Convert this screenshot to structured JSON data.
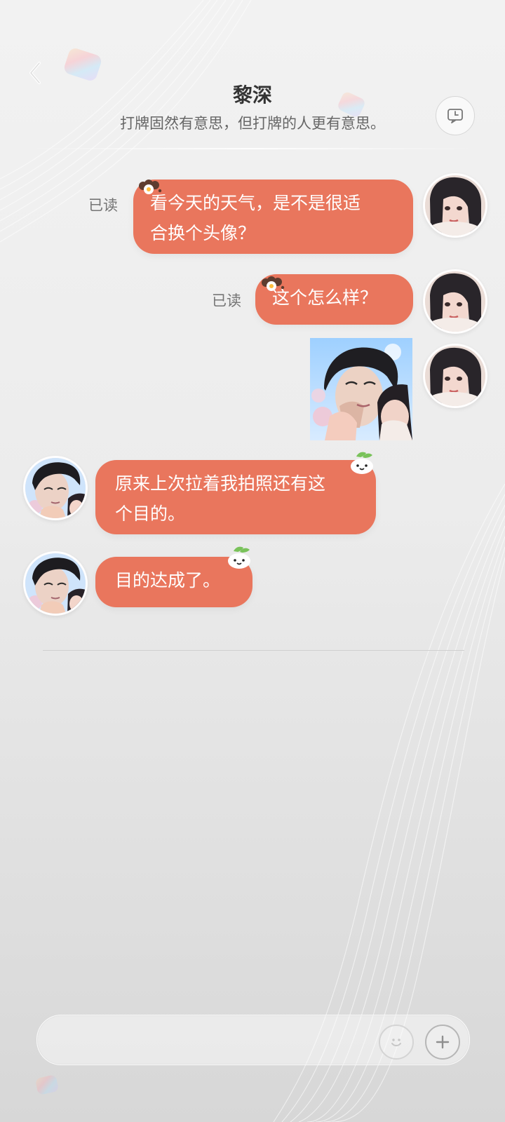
{
  "header": {
    "title": "黎深",
    "subtitle": "打牌固然有意思，但打牌的人更有意思。"
  },
  "messages": [
    {
      "status": "已读",
      "text_line1": "看今天的天气，是不是很适",
      "text_line2": "合换个头像？"
    },
    {
      "status": "已读",
      "text": "这个怎么样？"
    },
    {
      "text_line1": "原来上次拉着我拍照还有这",
      "text_line2": "个目的。"
    },
    {
      "text": "目的达成了。"
    }
  ],
  "input": {
    "placeholder": ""
  },
  "colors": {
    "bubble": "#e9765d",
    "status_text": "#757575",
    "background": "#ececec"
  },
  "icons": {
    "back": "back-icon",
    "header_action": "message-history-icon",
    "emoji": "emoji-icon",
    "plus": "plus-icon"
  }
}
